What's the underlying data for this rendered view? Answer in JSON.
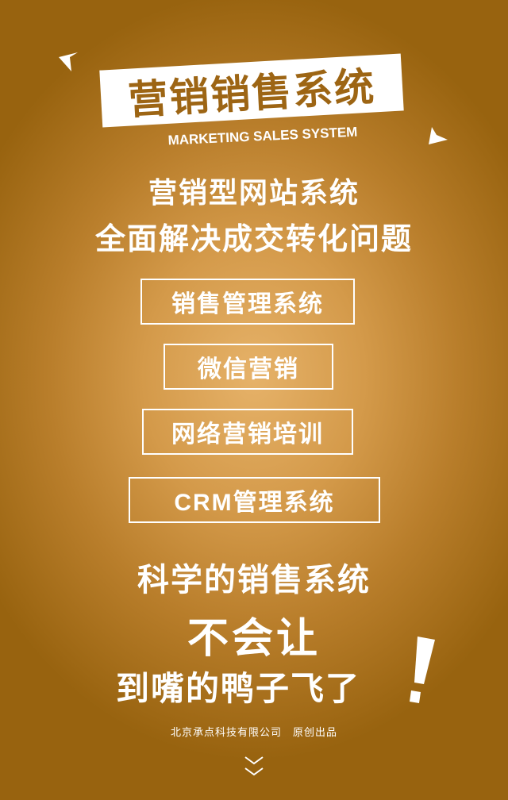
{
  "title": "营销销售系统",
  "subtitle_en": "MARKETING SALES SYSTEM",
  "headline": {
    "line1": "营销型网站系统",
    "line2": "全面解决成交转化问题"
  },
  "features": [
    {
      "label": "销售管理系统"
    },
    {
      "label": "微信营销"
    },
    {
      "label": "网络营销培训"
    },
    {
      "label": "CRM管理系统"
    }
  ],
  "slogan": {
    "line1": "科学的销售系统",
    "line2": "不会让",
    "line3": "到嘴的鸭子飞了"
  },
  "footer": "北京承点科技有限公司　原创出品",
  "colors": {
    "background": "#c8903c",
    "title_text": "#9d6514",
    "foreground": "#ffffff"
  },
  "icons": [
    "arrow-top-left-icon",
    "arrow-right-icon",
    "exclamation-icon",
    "chevron-down-icon"
  ]
}
